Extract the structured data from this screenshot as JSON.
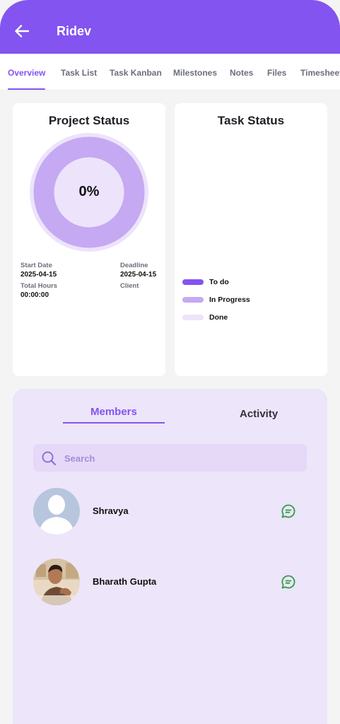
{
  "header": {
    "title": "Ridev"
  },
  "tabs": [
    {
      "label": "Overview",
      "active": true
    },
    {
      "label": "Task List",
      "active": false
    },
    {
      "label": "Task Kanban",
      "active": false
    },
    {
      "label": "Milestones",
      "active": false
    },
    {
      "label": "Notes",
      "active": false
    },
    {
      "label": "Files",
      "active": false
    },
    {
      "label": "Timesheet",
      "active": false
    }
  ],
  "project_status": {
    "title": "Project Status",
    "percent_label": "0%",
    "progress": 0,
    "start_date_label": "Start Date",
    "start_date": "2025-04-15",
    "deadline_label": "Deadline",
    "deadline": "2025-04-15",
    "total_hours_label": "Total Hours",
    "total_hours": "00:00:00",
    "client_label": "Client",
    "client": ""
  },
  "task_status": {
    "title": "Task Status",
    "legend": [
      {
        "label": "To do",
        "color": "#8354f0"
      },
      {
        "label": "In Progress",
        "color": "#c5a9f2"
      },
      {
        "label": "Done",
        "color": "#ede3fb"
      }
    ]
  },
  "members_panel": {
    "tabs": [
      {
        "label": "Members",
        "active": true
      },
      {
        "label": "Activity",
        "active": false
      }
    ],
    "search_placeholder": "Search",
    "members": [
      {
        "name": "Shravya",
        "avatar": "default-avatar-icon"
      },
      {
        "name": "Bharath Gupta",
        "avatar": "photo-avatar"
      }
    ]
  },
  "colors": {
    "primary": "#8354f0",
    "chat_icon": "#2ea043",
    "panel_bg": "#ede5fa"
  }
}
